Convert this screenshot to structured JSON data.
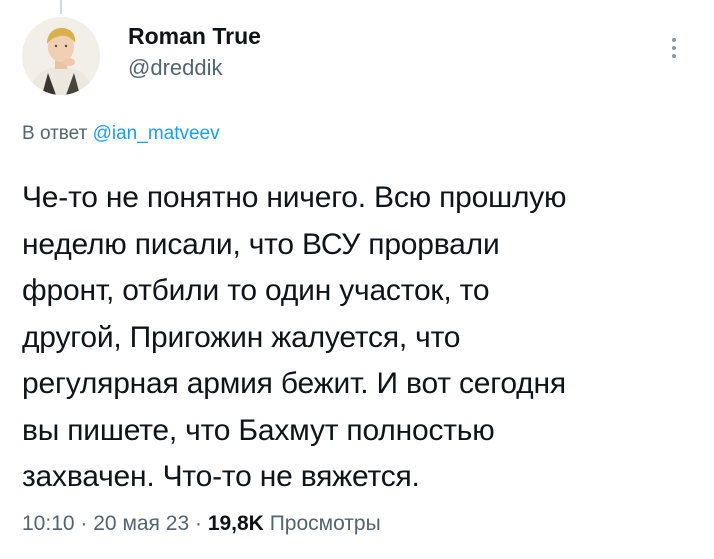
{
  "author": {
    "display_name": "Roman True",
    "handle": "@dreddik"
  },
  "reply": {
    "prefix": "В ответ",
    "mention": "@ian_matveev"
  },
  "tweet": {
    "text": "Че-то не понятно ничего. Всю прошлую\nнеделю писали, что ВСУ прорвали\nфронт, отбили то один участок, то\nдругой, Пригожин жалуется, что\nрегулярная армия бежит. И вот сегодня\nвы пишете, что Бахмут полностью\nзахвачен. Что-то не вяжется."
  },
  "meta": {
    "time": "10:10",
    "separator": "·",
    "date": "20 мая 23",
    "views_count": "19,8K",
    "views_label": "Просмотры"
  },
  "icons": {
    "more": "more-vertical-icon",
    "avatar": "user-avatar-image"
  },
  "colors": {
    "text": "#0f1419",
    "secondary": "#536471",
    "link": "#1d9bf0"
  }
}
